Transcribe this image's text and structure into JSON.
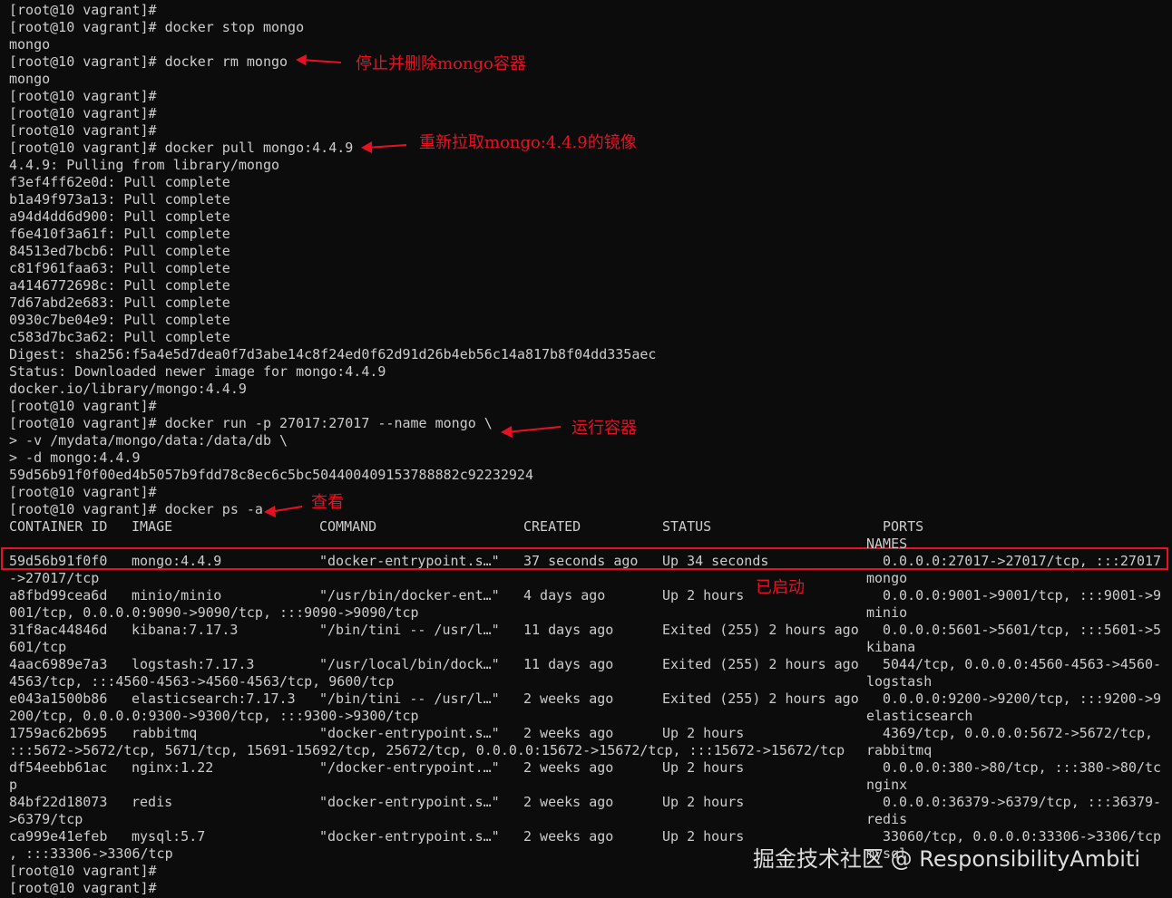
{
  "colors": {
    "background": "#0c0c0c",
    "text": "#cccccc",
    "annotation": "#e81123",
    "watermark": "#dddddd"
  },
  "terminal": {
    "lines_top": [
      "[root@10 vagrant]#",
      "[root@10 vagrant]# docker stop mongo",
      "mongo",
      "[root@10 vagrant]# docker rm mongo",
      "mongo",
      "[root@10 vagrant]#",
      "[root@10 vagrant]#",
      "[root@10 vagrant]#",
      "[root@10 vagrant]# docker pull mongo:4.4.9",
      "4.4.9: Pulling from library/mongo",
      "f3ef4ff62e0d: Pull complete",
      "b1a49f973a13: Pull complete",
      "a94d4dd6d900: Pull complete",
      "f6e410f3a61f: Pull complete",
      "84513ed7bcb6: Pull complete",
      "c81f961faa63: Pull complete",
      "a4146772698c: Pull complete",
      "7d67abd2e683: Pull complete",
      "0930c7be04e9: Pull complete",
      "c583d7bc3a62: Pull complete",
      "Digest: sha256:f5a4e5d7dea0f7d3abe14c8f24ed0f62d91d26b4eb56c14a817b8f04dd335aec",
      "Status: Downloaded newer image for mongo:4.4.9",
      "docker.io/library/mongo:4.4.9",
      "[root@10 vagrant]#",
      "[root@10 vagrant]# docker run -p 27017:27017 --name mongo \\",
      "> -v /mydata/mongo/data:/data/db \\",
      "> -d mongo:4.4.9",
      "59d56b91f0f00ed4b5057b9fdd78c8ec6c5bc504400409153788882c92232924",
      "[root@10 vagrant]#",
      "[root@10 vagrant]# docker ps -a"
    ],
    "headers": {
      "container_id": "CONTAINER ID",
      "image": "IMAGE",
      "command": "COMMAND",
      "created": "CREATED",
      "status": "STATUS",
      "ports": "PORTS",
      "names": "NAMES"
    },
    "rows": [
      {
        "id": "59d56b91f0f0",
        "image": "mongo:4.4.9",
        "command": "\"docker-entrypoint.s…\"",
        "created": "37 seconds ago",
        "status": "Up 34 seconds",
        "ports": "0.0.0.0:27017->27017/tcp, :::27017",
        "wrap": "->27017/tcp",
        "name": "mongo"
      },
      {
        "id": "a8fbd99cea6d",
        "image": "minio/minio",
        "command": "\"/usr/bin/docker-ent…\"",
        "created": "4 days ago",
        "status": "Up 2 hours",
        "ports": "0.0.0.0:9001->9001/tcp, :::9001->9",
        "wrap": "001/tcp, 0.0.0.0:9090->9090/tcp, :::9090->9090/tcp",
        "name": "minio"
      },
      {
        "id": "31f8ac44846d",
        "image": "kibana:7.17.3",
        "command": "\"/bin/tini -- /usr/l…\"",
        "created": "11 days ago",
        "status": "Exited (255) 2 hours ago",
        "ports": "0.0.0.0:5601->5601/tcp, :::5601->5",
        "wrap": "601/tcp",
        "name": "kibana"
      },
      {
        "id": "4aac6989e7a3",
        "image": "logstash:7.17.3",
        "command": "\"/usr/local/bin/dock…\"",
        "created": "11 days ago",
        "status": "Exited (255) 2 hours ago",
        "ports": "5044/tcp, 0.0.0.0:4560-4563->4560-",
        "wrap": "4563/tcp, :::4560-4563->4560-4563/tcp, 9600/tcp",
        "name": "logstash"
      },
      {
        "id": "e043a1500b86",
        "image": "elasticsearch:7.17.3",
        "command": "\"/bin/tini -- /usr/l…\"",
        "created": "2 weeks ago",
        "status": "Exited (255) 2 hours ago",
        "ports": "0.0.0.0:9200->9200/tcp, :::9200->9",
        "wrap": "200/tcp, 0.0.0.0:9300->9300/tcp, :::9300->9300/tcp",
        "name": "elasticsearch"
      },
      {
        "id": "1759ac62b695",
        "image": "rabbitmq",
        "command": "\"docker-entrypoint.s…\"",
        "created": "2 weeks ago",
        "status": "Up 2 hours",
        "ports": "4369/tcp, 0.0.0.0:5672->5672/tcp,",
        "wrap": ":::5672->5672/tcp, 5671/tcp, 15691-15692/tcp, 25672/tcp, 0.0.0.0:15672->15672/tcp, :::15672->15672/tcp",
        "name": "rabbitmq"
      },
      {
        "id": "df54eebb61ac",
        "image": "nginx:1.22",
        "command": "\"/docker-entrypoint.…\"",
        "created": "2 weeks ago",
        "status": "Up 2 hours",
        "ports": "0.0.0.0:380->80/tcp, :::380->80/tc",
        "wrap": "p",
        "name": "nginx"
      },
      {
        "id": "84bf22d18073",
        "image": "redis",
        "command": "\"docker-entrypoint.s…\"",
        "created": "2 weeks ago",
        "status": "Up 2 hours",
        "ports": "0.0.0.0:36379->6379/tcp, :::36379-",
        "wrap": ">6379/tcp",
        "name": "redis"
      },
      {
        "id": "ca999e41efeb",
        "image": "mysql:5.7",
        "command": "\"docker-entrypoint.s…\"",
        "created": "2 weeks ago",
        "status": "Up 2 hours",
        "ports": "33060/tcp, 0.0.0.0:33306->3306/tcp",
        "wrap": ", :::33306->3306/tcp",
        "name": "mysql"
      }
    ],
    "lines_bottom": [
      "[root@10 vagrant]#",
      "[root@10 vagrant]#"
    ]
  },
  "annotations": {
    "stop_remove": "停止并删除mongo容器",
    "repull": "重新拉取mongo:4.4.9的镜像",
    "run": "运行容器",
    "view": "查看",
    "started": "已启动"
  },
  "watermark": "掘金技术社区 @ ResponsibilityAmbiti"
}
